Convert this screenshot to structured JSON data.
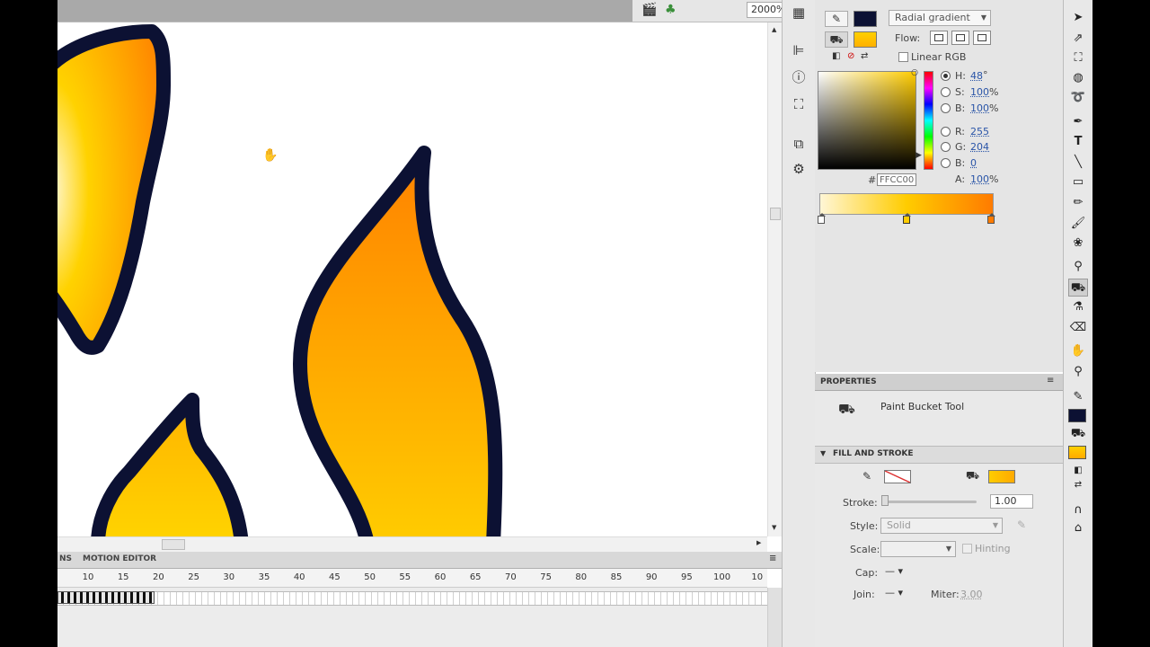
{
  "editbar": {
    "zoom": "2000%"
  },
  "timeline": {
    "tab_partial": "NS",
    "tab_motion": "MOTION EDITOR",
    "ticks": [
      "10",
      "15",
      "20",
      "25",
      "30",
      "35",
      "40",
      "45",
      "50",
      "55",
      "60",
      "65",
      "70",
      "75",
      "80",
      "85",
      "90",
      "95",
      "100",
      "10"
    ]
  },
  "color_panel": {
    "type": "Radial gradient",
    "flow_label": "Flow:",
    "linear_rgb_label": "Linear RGB",
    "stroke_color": "#0c1133",
    "fill_color": "#ffcc00",
    "h": {
      "label": "H:",
      "value": "48",
      "unit": "°"
    },
    "s": {
      "label": "S:",
      "value": "100",
      "unit": "%"
    },
    "b": {
      "label": "B:",
      "value": "100",
      "unit": "%"
    },
    "r": {
      "label": "R:",
      "value": "255"
    },
    "g": {
      "label": "G:",
      "value": "204"
    },
    "bl": {
      "label": "B:",
      "value": "0"
    },
    "hex_prefix": "#",
    "hex": "FFCC00",
    "a": {
      "label": "A:",
      "value": "100",
      "unit": "%"
    }
  },
  "properties": {
    "title": "PROPERTIES",
    "tool_name": "Paint Bucket Tool",
    "section": "FILL AND STROKE",
    "stroke_label": "Stroke:",
    "stroke_value": "1.00",
    "style_label": "Style:",
    "style_value": "Solid",
    "scale_label": "Scale:",
    "hinting_label": "Hinting",
    "cap_label": "Cap:",
    "join_label": "Join:",
    "miter_label": "Miter:",
    "miter_value": "3.00"
  }
}
